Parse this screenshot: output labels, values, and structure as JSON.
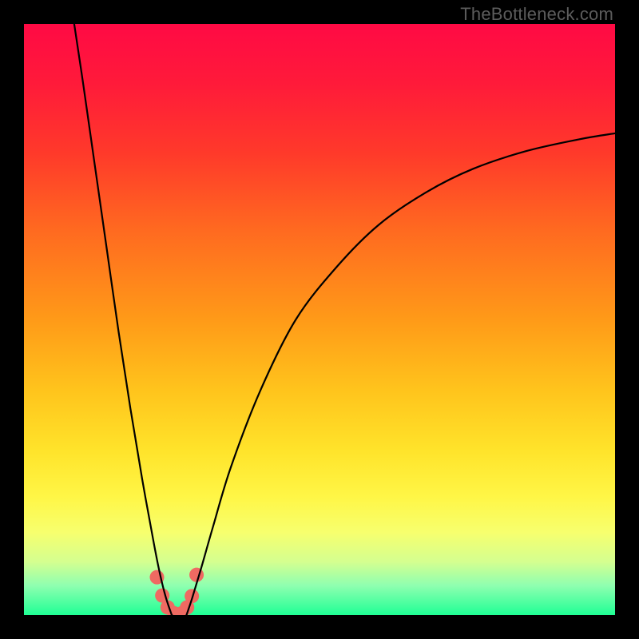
{
  "watermark": "TheBottleneck.com",
  "gradient": {
    "stops": [
      {
        "offset": 0.0,
        "color": "#ff0a44"
      },
      {
        "offset": 0.1,
        "color": "#ff1a3a"
      },
      {
        "offset": 0.22,
        "color": "#ff3a2a"
      },
      {
        "offset": 0.35,
        "color": "#ff6a20"
      },
      {
        "offset": 0.5,
        "color": "#ff9a18"
      },
      {
        "offset": 0.62,
        "color": "#ffc41c"
      },
      {
        "offset": 0.72,
        "color": "#ffe32a"
      },
      {
        "offset": 0.8,
        "color": "#fff646"
      },
      {
        "offset": 0.86,
        "color": "#f7ff6e"
      },
      {
        "offset": 0.91,
        "color": "#d4ff90"
      },
      {
        "offset": 0.95,
        "color": "#8fffb0"
      },
      {
        "offset": 1.0,
        "color": "#1fff95"
      }
    ]
  },
  "chart_data": {
    "type": "line",
    "title": "",
    "xlabel": "",
    "ylabel": "",
    "xlim": [
      0,
      100
    ],
    "ylim": [
      0,
      100
    ],
    "series": [
      {
        "name": "left-branch",
        "color": "#000000",
        "x": [
          8.5,
          10,
          12,
          14,
          16,
          18,
          20,
          22,
          23,
          24,
          25
        ],
        "y": [
          100,
          90,
          76,
          62,
          48,
          35,
          23,
          12,
          7,
          3,
          0
        ]
      },
      {
        "name": "right-branch",
        "color": "#000000",
        "x": [
          27.5,
          28.5,
          30,
          32,
          35,
          40,
          46,
          53,
          60,
          68,
          76,
          85,
          94,
          100
        ],
        "y": [
          0,
          3,
          8,
          15,
          25,
          38,
          50,
          59,
          66,
          71.5,
          75.5,
          78.5,
          80.5,
          81.5
        ]
      },
      {
        "name": "valley-floor",
        "color": "#000000",
        "x": [
          25,
          25.8,
          26.5,
          27.2,
          27.5
        ],
        "y": [
          0,
          -0.5,
          -0.6,
          -0.5,
          0
        ]
      }
    ],
    "markers": {
      "name": "valley-dots",
      "color": "#ef6a62",
      "radius_px": 9,
      "points": [
        {
          "x": 22.5,
          "y": 6.4
        },
        {
          "x": 23.4,
          "y": 3.3
        },
        {
          "x": 24.3,
          "y": 1.3
        },
        {
          "x": 25.4,
          "y": 0.3
        },
        {
          "x": 26.7,
          "y": 0.3
        },
        {
          "x": 27.6,
          "y": 1.3
        },
        {
          "x": 28.4,
          "y": 3.2
        },
        {
          "x": 29.2,
          "y": 6.8
        }
      ]
    }
  }
}
